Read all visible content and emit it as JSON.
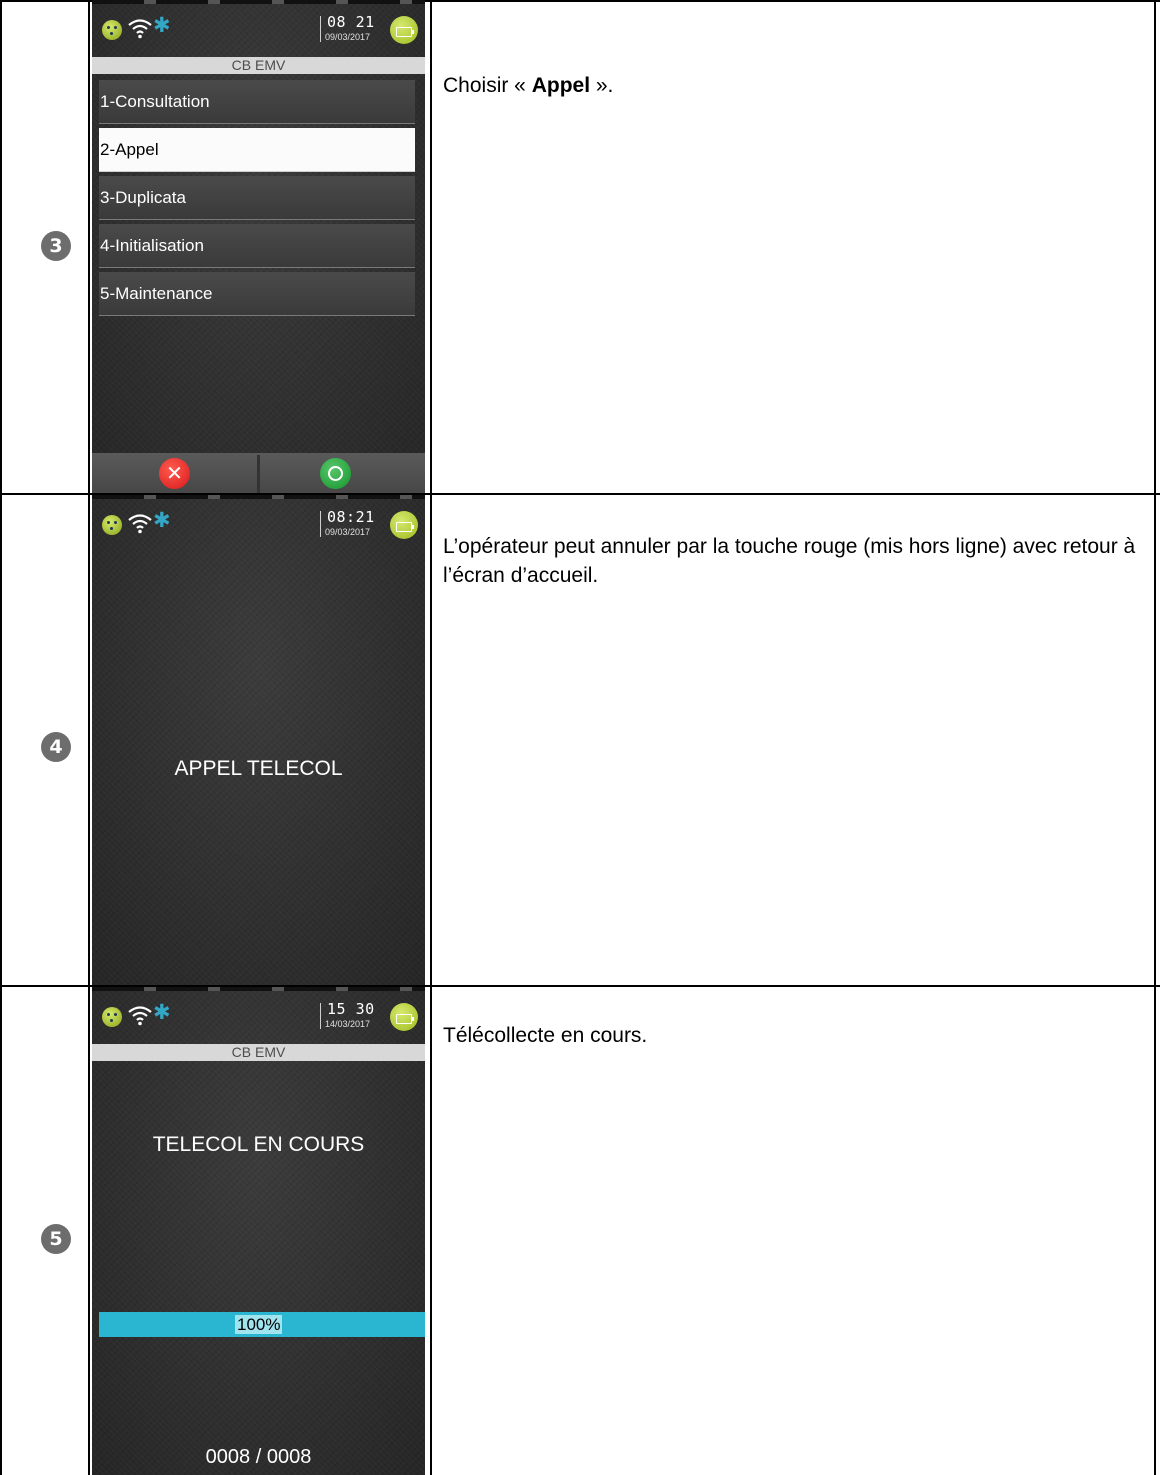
{
  "steps": [
    {
      "number": "3",
      "description_prefix": "Choisir « ",
      "description_bold": "Appel",
      "description_suffix": " ».",
      "screen": {
        "time": "08 21",
        "date": "09/03/2017",
        "subheader": "CB EMV",
        "menu": [
          {
            "label": "1-Consultation",
            "selected": false
          },
          {
            "label": "2-Appel",
            "selected": true
          },
          {
            "label": "3-Duplicata",
            "selected": false
          },
          {
            "label": "4-Initialisation",
            "selected": false
          },
          {
            "label": "5-Maintenance",
            "selected": false
          }
        ],
        "cancel_glyph": "✕"
      }
    },
    {
      "number": "4",
      "description": "L’opérateur peut annuler par la touche rouge (mis hors ligne) avec retour à l’écran d’accueil.",
      "screen": {
        "time": "08:21",
        "date": "09/03/2017",
        "message": "APPEL TELECOL"
      }
    },
    {
      "number": "5",
      "description": "Télécollecte en cours.",
      "screen": {
        "time": "15 30",
        "date": "14/03/2017",
        "subheader": "CB EMV",
        "message": "TELECOL EN COURS",
        "progress_percent": 100,
        "progress_label": "100%",
        "counter": "0008 / 0008"
      }
    }
  ],
  "colors": {
    "accent_battery": "#9dbb1f",
    "bluetooth": "#34a6c6",
    "progress": "#2ab6d1",
    "cancel": "#d8181a",
    "ok": "#14952c"
  },
  "icons": [
    "smiley-status-icon",
    "wifi-icon",
    "bluetooth-icon",
    "battery-icon",
    "cancel-x-icon",
    "ok-circle-icon"
  ]
}
